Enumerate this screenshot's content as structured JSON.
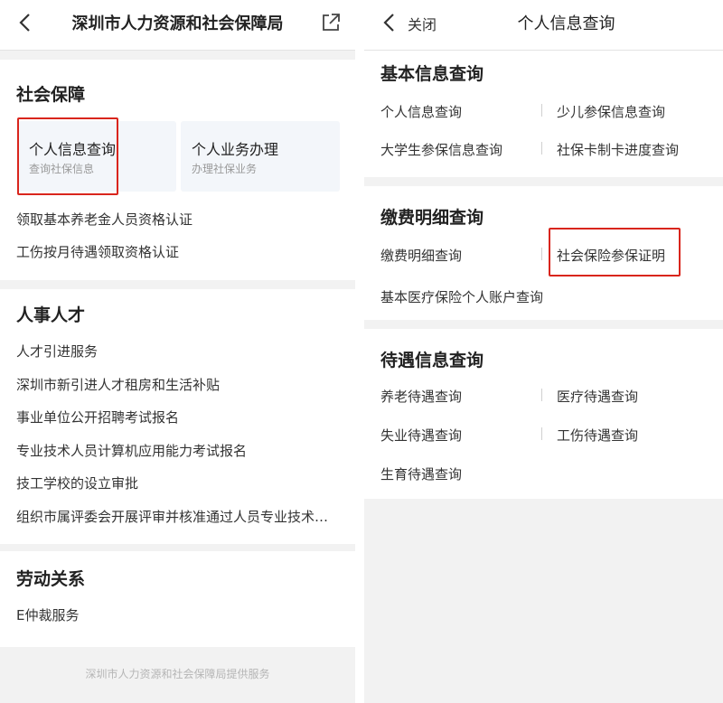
{
  "left": {
    "nav": {
      "title": "深圳市人力资源和社会保障局"
    },
    "social": {
      "title": "社会保障",
      "cards": [
        {
          "title": "个人信息查询",
          "sub": "查询社保信息"
        },
        {
          "title": "个人业务办理",
          "sub": "办理社保业务"
        }
      ],
      "items": [
        "领取基本养老金人员资格认证",
        "工伤按月待遇领取资格认证"
      ]
    },
    "hr": {
      "title": "人事人才",
      "items": [
        "人才引进服务",
        "深圳市新引进人才租房和生活补贴",
        "事业单位公开招聘考试报名",
        "专业技术人员计算机应用能力考试报名",
        "技工学校的设立审批",
        "组织市属评委会开展评审并核准通过人员专业技术…"
      ]
    },
    "labor": {
      "title": "劳动关系",
      "items": [
        "E仲裁服务"
      ]
    },
    "footer": "深圳市人力资源和社会保障局提供服务"
  },
  "right": {
    "nav": {
      "close_label": "关闭",
      "title": "个人信息查询"
    },
    "basic": {
      "title": "基本信息查询",
      "items": [
        "个人信息查询",
        "少儿参保信息查询",
        "大学生参保信息查询",
        "社保卡制卡进度查询"
      ]
    },
    "payment": {
      "title": "缴费明细查询",
      "items": [
        "缴费明细查询",
        "社会保险参保证明",
        "基本医疗保险个人账户查询"
      ]
    },
    "benefit": {
      "title": "待遇信息查询",
      "items": [
        "养老待遇查询",
        "医疗待遇查询",
        "失业待遇查询",
        "工伤待遇查询",
        "生育待遇查询"
      ]
    }
  },
  "colors": {
    "highlight": "#d9251c",
    "card_bg": "#f3f6fa",
    "page_bg": "#f2f2f2"
  },
  "icons": {
    "back": "chevron-left",
    "share": "share-external"
  }
}
